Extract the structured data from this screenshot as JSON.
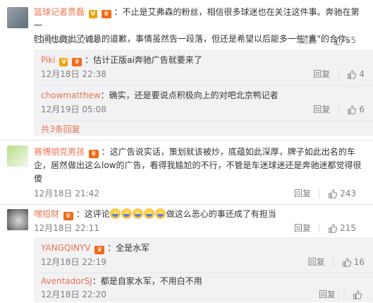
{
  "comments": [
    {
      "user": "篮球记者贾磊",
      "separator": "：",
      "text_line1": "不止是艾弗森的粉丝，相信很多球迷也在关注这件事。奔驰在第一",
      "text_line2": "时间也做出了诚恳的道歉，事情虽然告一段落，但还是希望以后能多一些\"真\"的合作。",
      "time": "12月18日 22:36",
      "reply_label": "回复",
      "likes": "55",
      "replies": [
        {
          "user": "Piki",
          "separator": "：",
          "text": "估计正版ai奔驰广告就要来了",
          "time": "12月18日 22:38",
          "reply_label": "回复",
          "likes": "4"
        },
        {
          "user": "chowmatthew",
          "separator": "：",
          "text": "确实，还是要说点积极向上的对吧北京鸭记者",
          "time": "12月19日 05:08",
          "reply_label": "回复",
          "likes": "6"
        }
      ],
      "more_replies": "共3条回复"
    },
    {
      "user": "赛博朋克男孩",
      "separator": "：",
      "text_line1": "这广告说实话，策划就该被炒，底蕴如此深厚，牌子如此出名的车",
      "text_line2": "企，居然做出这么low的广告，看得我尴尬的不行，不管是车迷球迷还是奔驰迷都觉得很",
      "text_line3": "傻",
      "time": "12月18日 21:42",
      "reply_label": "回复",
      "likes": "243"
    },
    {
      "user": "嘿招财",
      "separator": "：",
      "text_before": "这评论",
      "text_after": "做这么恶心的事还成了有担当",
      "time": "12月18日 22:11",
      "reply_label": "回复",
      "likes": "215",
      "replies": [
        {
          "user": "YANGQINYV",
          "separator": "：",
          "text": "全是水军",
          "time": "12月18日 22:19",
          "reply_label": "回复",
          "likes": "16"
        },
        {
          "user": "AventadorSJ",
          "separator": "：",
          "text": "都是自家水军，不用白不用",
          "time": "12月18日 22:20",
          "reply_label": "回复",
          "likes": ""
        }
      ]
    }
  ],
  "badges": {
    "v": "V",
    "vip": "♛"
  },
  "icons": {
    "like": "thumb-up-icon",
    "emoji": "crying-laugh-emoji"
  },
  "colors": {
    "username": "#eb7350",
    "meta": "#808080",
    "reply_bg": "#f2f2f5",
    "text": "#333333"
  }
}
